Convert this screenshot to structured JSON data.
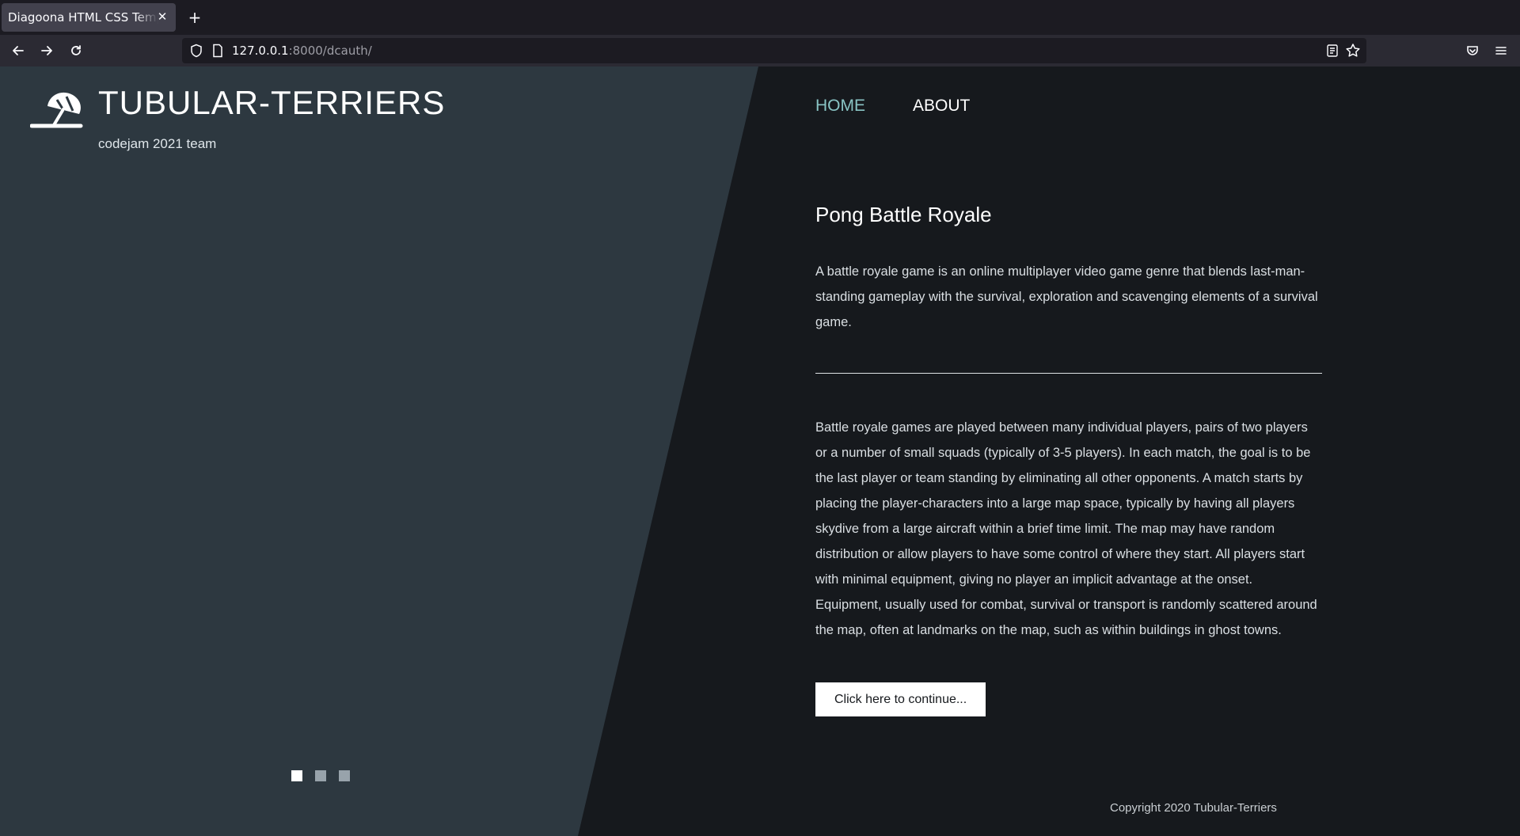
{
  "browser": {
    "tab_title": "Diagoona HTML CSS Template",
    "url_host": "127.0.0.1",
    "url_rest": ":8000/dcauth/"
  },
  "site": {
    "title": "TUBULAR-TERRIERS",
    "tagline": "codejam 2021 team",
    "logo_icon": "beach-umbrella-icon"
  },
  "nav": {
    "items": [
      {
        "label": "HOME",
        "active": true
      },
      {
        "label": "ABOUT",
        "active": false
      }
    ]
  },
  "article": {
    "title": "Pong Battle Royale",
    "intro": "A battle royale game is an online multiplayer video game genre that blends last-man-standing gameplay with the survival, exploration and scavenging elements of a survival game.",
    "body": "Battle royale games are played between many individual players, pairs of two players or a number of small squads (typically of 3-5 players). In each match, the goal is to be the last player or team standing by eliminating all other opponents. A match starts by placing the player-characters into a large map space, typically by having all players skydive from a large aircraft within a brief time limit. The map may have random distribution or allow players to have some control of where they start. All players start with minimal equipment, giving no player an implicit advantage at the onset. Equipment, usually used for combat, survival or transport is randomly scattered around the map, often at landmarks on the map, such as within buildings in ghost towns.",
    "button_label": "Click here to continue..."
  },
  "slider": {
    "count": 3,
    "active_index": 0
  },
  "footer": {
    "copyright": "Copyright 2020 Tubular-Terriers"
  },
  "colors": {
    "left_panel": "#2d3840",
    "page_bg": "#16191d",
    "active_nav": "#89c4c4"
  }
}
